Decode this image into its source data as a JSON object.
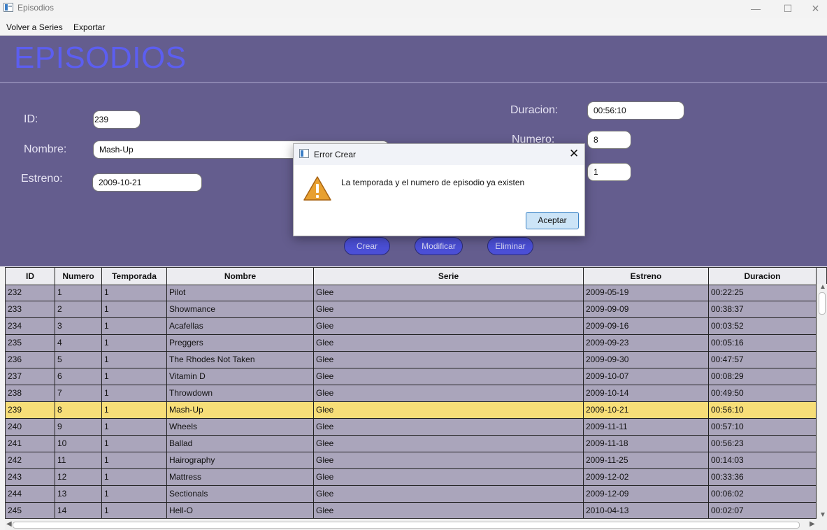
{
  "window": {
    "title": "Episodios",
    "minimize": "—",
    "maximize": "☐",
    "close": "✕"
  },
  "menu": {
    "items": [
      "Volver a Series",
      "Exportar"
    ]
  },
  "page": {
    "title": "EPISODIOS"
  },
  "form": {
    "id_label": "ID:",
    "id_value": "239",
    "nombre_label": "Nombre:",
    "nombre_value": "Mash-Up",
    "estreno_label": "Estreno:",
    "estreno_value": "2009-10-21",
    "duracion_label": "Duracion:",
    "duracion_value": "00:56:10",
    "numero_label": "Numero:",
    "numero_value": "8",
    "temporada_value": "1"
  },
  "buttons": {
    "crear": "Crear",
    "modificar": "Modificar",
    "eliminar": "Eliminar"
  },
  "table": {
    "columns": [
      "ID",
      "Numero",
      "Temporada",
      "Nombre",
      "Serie",
      "Estreno",
      "Duracion"
    ],
    "selected_id": "239",
    "rows": [
      [
        "232",
        "1",
        "1",
        "Pilot",
        "Glee",
        "2009-05-19",
        "00:22:25"
      ],
      [
        "233",
        "2",
        "1",
        "Showmance",
        "Glee",
        "2009-09-09",
        "00:38:37"
      ],
      [
        "234",
        "3",
        "1",
        "Acafellas",
        "Glee",
        "2009-09-16",
        "00:03:52"
      ],
      [
        "235",
        "4",
        "1",
        "Preggers",
        "Glee",
        "2009-09-23",
        "00:05:16"
      ],
      [
        "236",
        "5",
        "1",
        "The Rhodes Not Taken",
        "Glee",
        "2009-09-30",
        "00:47:57"
      ],
      [
        "237",
        "6",
        "1",
        "Vitamin D",
        "Glee",
        "2009-10-07",
        "00:08:29"
      ],
      [
        "238",
        "7",
        "1",
        "Throwdown",
        "Glee",
        "2009-10-14",
        "00:49:50"
      ],
      [
        "239",
        "8",
        "1",
        "Mash-Up",
        "Glee",
        "2009-10-21",
        "00:56:10"
      ],
      [
        "240",
        "9",
        "1",
        "Wheels",
        "Glee",
        "2009-11-11",
        "00:57:10"
      ],
      [
        "241",
        "10",
        "1",
        "Ballad",
        "Glee",
        "2009-11-18",
        "00:56:23"
      ],
      [
        "242",
        "11",
        "1",
        "Hairography",
        "Glee",
        "2009-11-25",
        "00:14:03"
      ],
      [
        "243",
        "12",
        "1",
        "Mattress",
        "Glee",
        "2009-12-02",
        "00:33:36"
      ],
      [
        "244",
        "13",
        "1",
        "Sectionals",
        "Glee",
        "2009-12-09",
        "00:06:02"
      ],
      [
        "245",
        "14",
        "1",
        "Hell-O",
        "Glee",
        "2010-04-13",
        "00:02:07"
      ]
    ]
  },
  "dialog": {
    "title": "Error Crear",
    "message": "La temporada y el numero de episodio ya existen",
    "ok_label": "Aceptar",
    "close": "✕",
    "icon": "warning-icon"
  },
  "colors": {
    "background": "#645d8e",
    "title": "#5c5ef0",
    "button": "#4b4fd6",
    "selected_row": "#f7de78",
    "table_bg": "#aaa5bb"
  }
}
